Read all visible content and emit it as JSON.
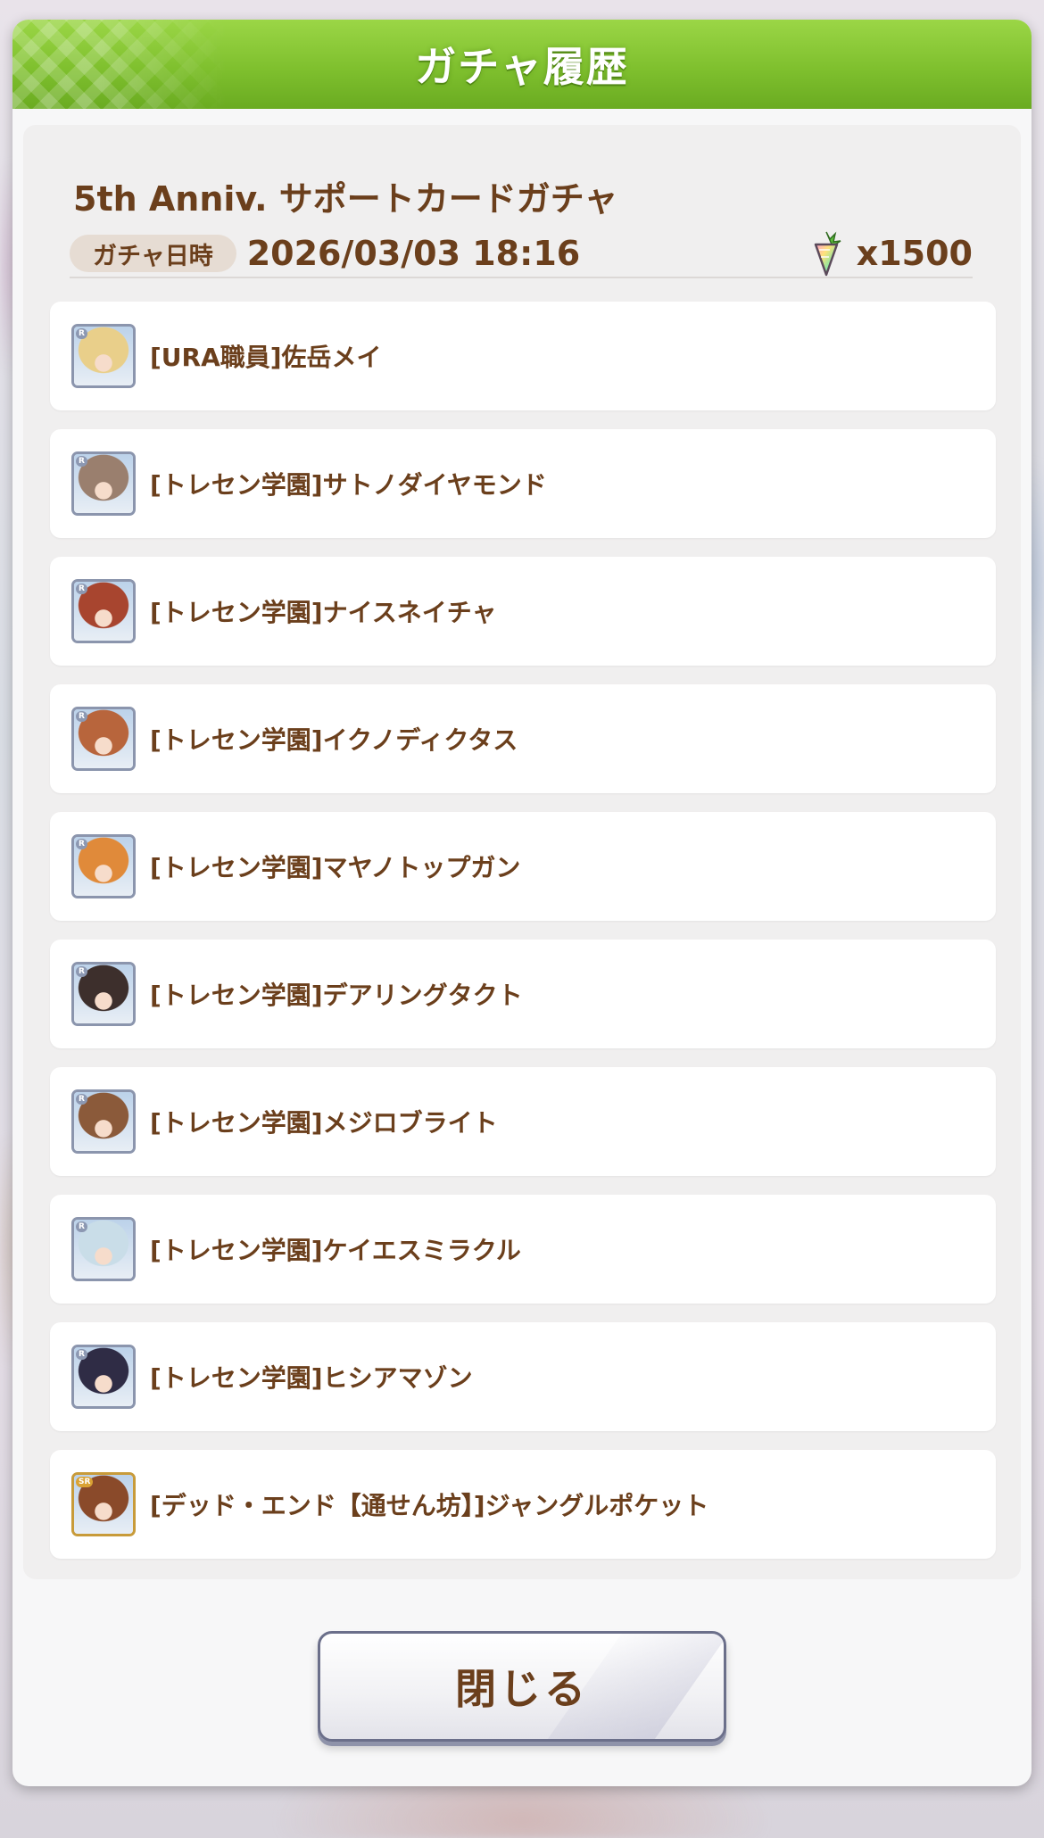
{
  "dialog": {
    "title": "ガチャ履歴",
    "gacha_name": "5th Anniv. サポートカードガチャ",
    "date_label": "ガチャ日時",
    "date_value": "2026/03/03 18:16",
    "cost_icon": "jewel-carrot-icon",
    "cost_value": "x1500",
    "close_label": "閉じる"
  },
  "items": [
    {
      "rarity": "R",
      "name": "[URA職員]佐岳メイ",
      "color": "#e9cf8a"
    },
    {
      "rarity": "R",
      "name": "[トレセン学園]サトノダイヤモンド",
      "color": "#9a7f6e"
    },
    {
      "rarity": "R",
      "name": "[トレセン学園]ナイスネイチャ",
      "color": "#a8452f"
    },
    {
      "rarity": "R",
      "name": "[トレセン学園]イクノディクタス",
      "color": "#b8653c"
    },
    {
      "rarity": "R",
      "name": "[トレセン学園]マヤノトップガン",
      "color": "#e08a3a"
    },
    {
      "rarity": "R",
      "name": "[トレセン学園]デアリングタクト",
      "color": "#3d2f2c"
    },
    {
      "rarity": "R",
      "name": "[トレセン学園]メジロブライト",
      "color": "#8b5a3a"
    },
    {
      "rarity": "R",
      "name": "[トレセン学園]ケイエスミラクル",
      "color": "#c9dde8"
    },
    {
      "rarity": "R",
      "name": "[トレセン学園]ヒシアマゾン",
      "color": "#2f2c45"
    },
    {
      "rarity": "SR",
      "name": "[デッド・エンド【通せん坊】]ジャングルポケット",
      "color": "#8a4a2a"
    }
  ],
  "colors": {
    "header_green": "#7fc02e",
    "text_brown": "#6b3f1c",
    "panel_bg": "#f0efef"
  }
}
